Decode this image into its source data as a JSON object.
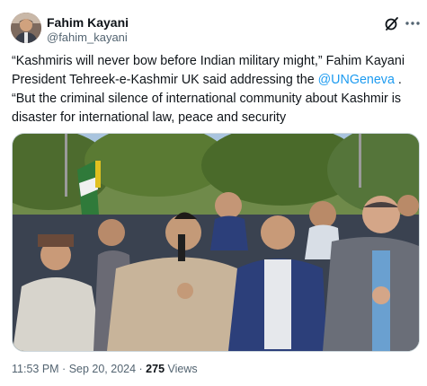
{
  "author": {
    "name": "Fahim Kayani",
    "handle": "@fahim_kayani"
  },
  "tweet": {
    "text_before": "“Kashmiris will never bow before Indian military might,” Fahim Kayani President Tehreek-e-Kashmir UK said addressing the ",
    "mention": "@UNGeneva",
    "text_after": " . “But the criminal silence of international community about Kashmir is disaster for international law, peace and security"
  },
  "meta": {
    "time": "11:53 PM",
    "sep1": " · ",
    "date": "Sep 20, 2024",
    "sep2": " · ",
    "views_count": "275",
    "views_label": " Views"
  },
  "icons": {
    "grok": "grok-icon",
    "more": "more-options-icon"
  },
  "colors": {
    "link": "#1d9bf0",
    "secondary_text": "#536471",
    "primary_text": "#0f1419"
  }
}
